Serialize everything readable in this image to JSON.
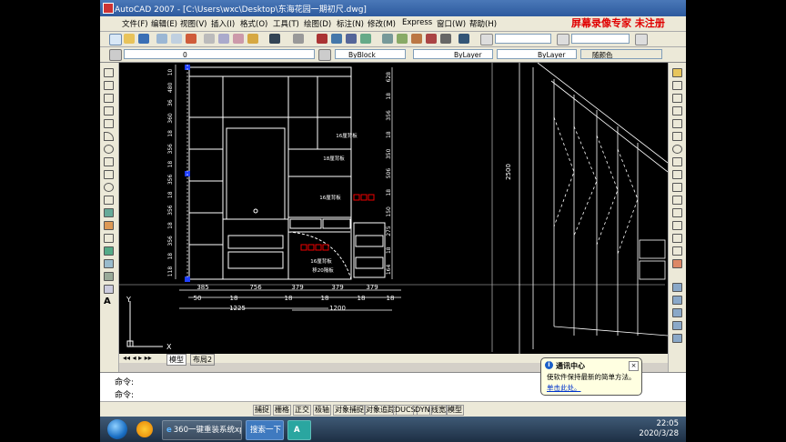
{
  "window": {
    "title": "AutoCAD 2007 - [C:\\Users\\wxc\\Desktop\\东海花园一期初尺.dwg]",
    "watermark": "屏幕录像专家 未注册"
  },
  "menu": [
    "文件(F)",
    "编辑(E)",
    "视图(V)",
    "插入(I)",
    "格式(O)",
    "工具(T)",
    "绘图(D)",
    "标注(N)",
    "修改(M)",
    "Express",
    "窗口(W)",
    "帮助(H)"
  ],
  "layers": {
    "layer_value": "0",
    "color_value": "ByBlock",
    "linetype_value": "ByLayer",
    "lineweight_value": "ByLayer",
    "plotstyle_value": "随颜色"
  },
  "drawing": {
    "dims_bottom": [
      "385",
      "756",
      "379",
      "379",
      "379"
    ],
    "dims_bottom2": [
      "50",
      "18",
      "18",
      "18",
      "18",
      "18"
    ],
    "dim_total_left": "1225",
    "dim_total_right": "1200",
    "dims_left": [
      "10",
      "480",
      "36",
      "360",
      "18",
      "356",
      "18",
      "356",
      "18",
      "356",
      "18",
      "356",
      "18",
      "118"
    ],
    "dims_right": [
      "628",
      "18",
      "356",
      "18",
      "350",
      "506",
      "18",
      "150",
      "275",
      "18",
      "164"
    ],
    "dim_height_iso": "2500",
    "labels": [
      "16厘背板",
      "18厘背板",
      "16厘背板",
      "16厘背板",
      "移20隔板"
    ],
    "ucs_x": "X",
    "ucs_y": "Y"
  },
  "tabs": [
    "模型",
    "布局2"
  ],
  "command": {
    "line1": "命令:",
    "line2": "命令:"
  },
  "status": [
    "捕捉",
    "栅格",
    "正交",
    "极轴",
    "对象捕捉",
    "对象追踪",
    "DUCS",
    "DYN",
    "线宽",
    "模型"
  ],
  "balloon": {
    "title": "通讯中心",
    "body": "使软件保持最新的简单方法。",
    "link": "单击此处。"
  },
  "taskbar": {
    "app1": "360一键重装系统xp",
    "app2": "搜索一下",
    "time": "22:05",
    "date": "2020/3/28"
  }
}
